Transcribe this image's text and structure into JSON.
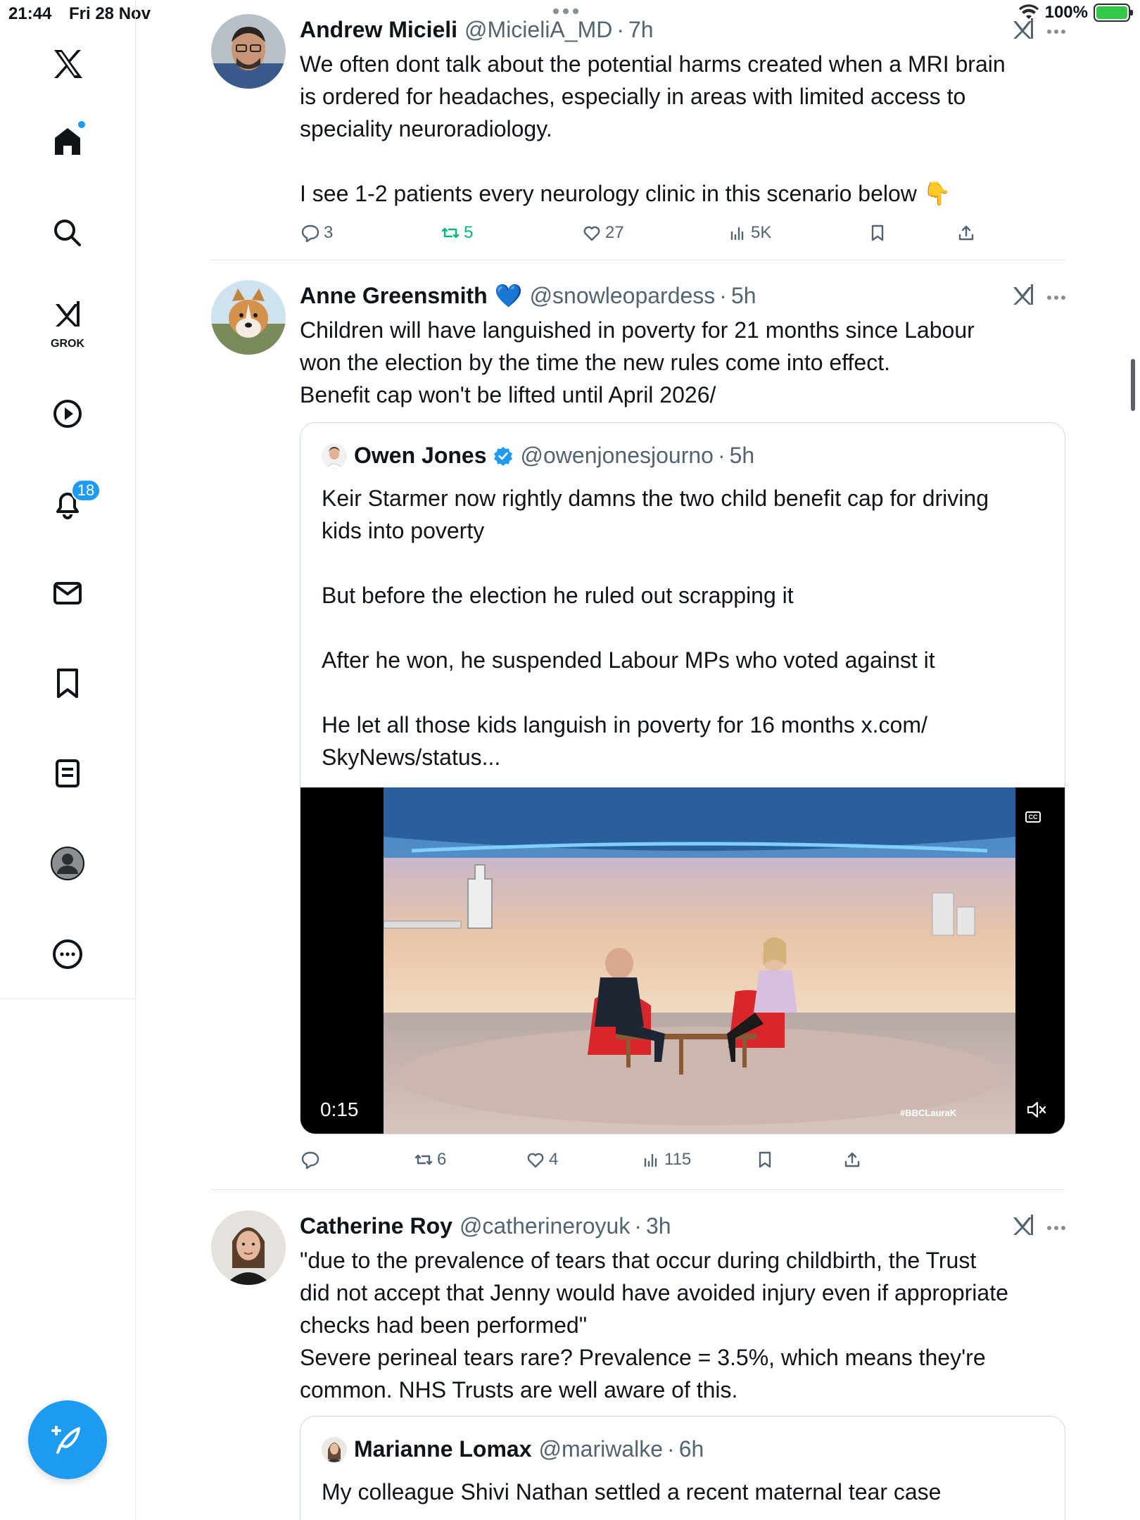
{
  "status_bar": {
    "time": "21:44",
    "date": "Fri 28 Nov",
    "battery": "100%"
  },
  "sidebar": {
    "grok_label": "GROK",
    "notifications_count": "18"
  },
  "tweets": [
    {
      "name": "Andrew Micieli",
      "handle": "@MicieliA_MD",
      "sep": "·",
      "time": "7h",
      "text": "We often dont talk about the potential harms created when a MRI brain\nis ordered for headaches, especially in areas with limited access to\nspeciality neuroradiology.\n\nI see 1-2 patients every neurology clinic in this scenario below 👇",
      "replies": "3",
      "reposts": "5",
      "likes": "27",
      "views": "5K"
    },
    {
      "name": "Anne Greensmith",
      "badge": "💙",
      "handle": "@snowleopardess",
      "sep": "·",
      "time": "5h",
      "text": "Children will have languished in poverty for 21 months since Labour\nwon the election by the time the new rules come into effect.\nBenefit cap won't be lifted until April 2026/",
      "quote": {
        "name": "Owen Jones",
        "handle": "@owenjonesjourno",
        "sep": "·",
        "time": "5h",
        "text": "Keir Starmer now rightly damns the two child benefit cap for driving\nkids into poverty\n\nBut before the election he ruled out scrapping it\n\nAfter he won, he suspended Labour MPs who voted against it\n\nHe let all those kids languish in poverty for 16 months x.com/\nSkyNews/status...",
        "video_duration": "0:15",
        "video_tag": "#BBCLauraK"
      },
      "replies": "",
      "reposts": "6",
      "likes": "4",
      "views": "115"
    },
    {
      "name": "Catherine Roy",
      "handle": "@catherineroyuk",
      "sep": "·",
      "time": "3h",
      "text": "\"due to the prevalence of tears that occur during childbirth, the Trust\ndid not accept that Jenny would have avoided injury even if appropriate\nchecks had been performed\"\nSevere perineal tears rare? Prevalence = 3.5%, which means they're\ncommon. NHS Trusts are well aware of this.",
      "quote": {
        "name": "Marianne Lomax",
        "handle": "@mariwalke",
        "sep": "·",
        "time": "6h",
        "text": "My colleague Shivi Nathan settled a recent maternal tear case"
      }
    }
  ],
  "colors": {
    "accent": "#1d9bf0",
    "repost_active": "#00ba7c",
    "secondary_text": "#536471"
  }
}
